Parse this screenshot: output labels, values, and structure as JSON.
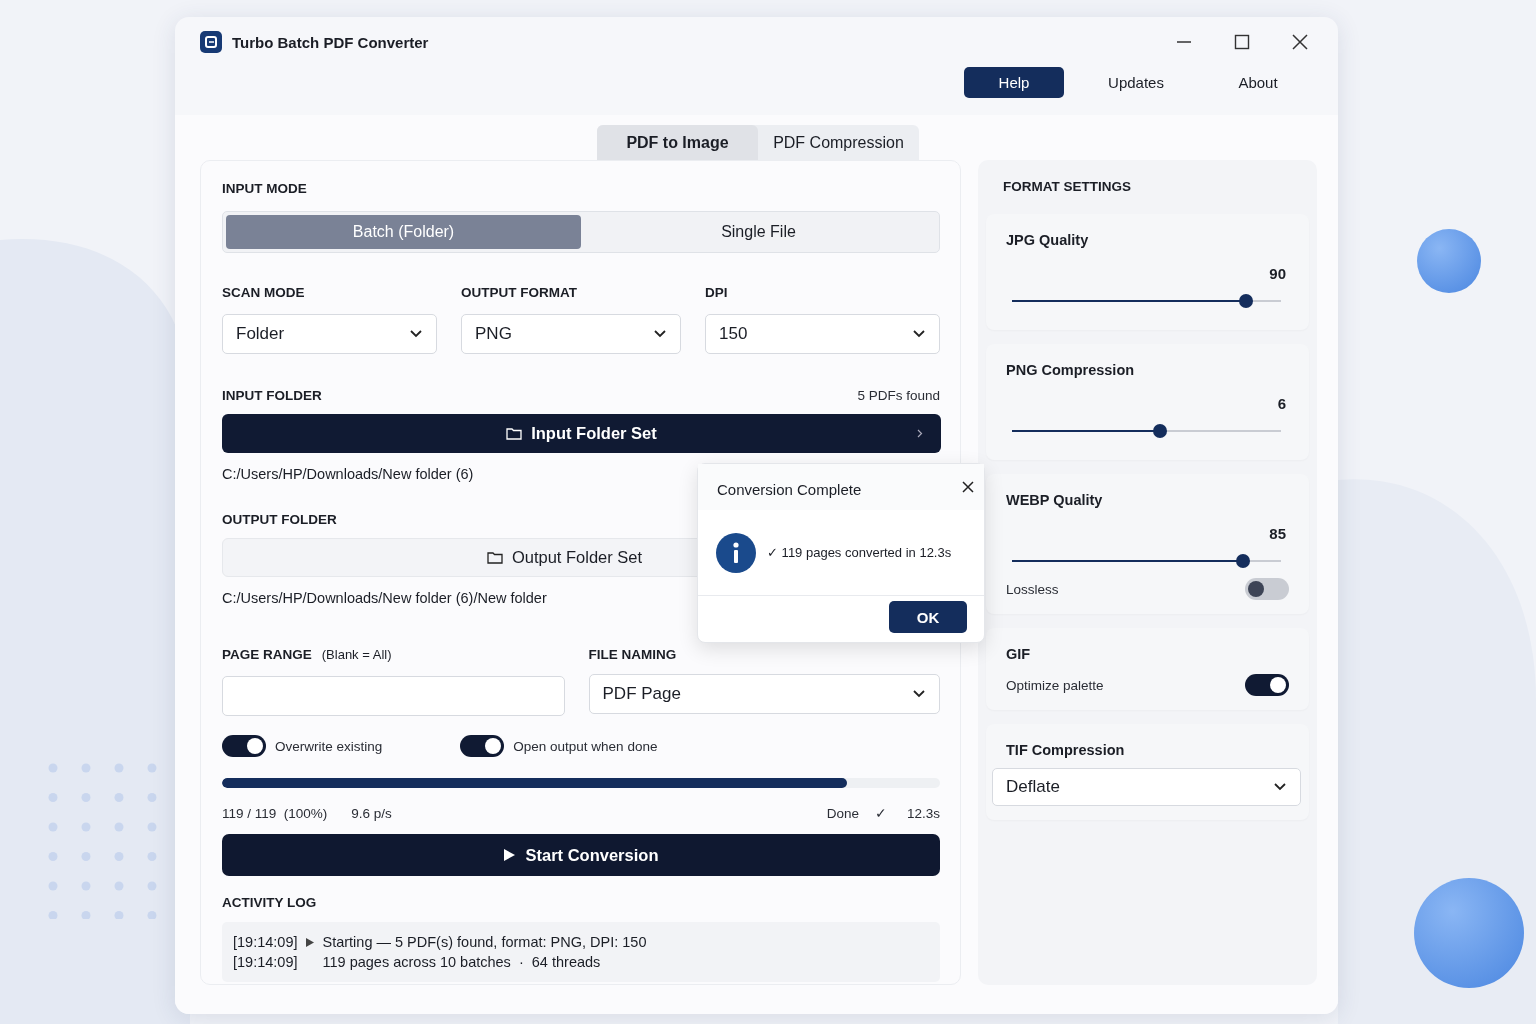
{
  "window": {
    "title": "Turbo Batch PDF Converter"
  },
  "nav_buttons": [
    {
      "label": "Help",
      "selected": true
    },
    {
      "label": "Updates",
      "selected": false
    },
    {
      "label": "About",
      "selected": false
    }
  ],
  "tabs": [
    {
      "label": "PDF to Image",
      "selected": true
    },
    {
      "label": "PDF Compression",
      "selected": false
    }
  ],
  "input_mode": {
    "label": "INPUT MODE",
    "options": [
      {
        "label": "Batch (Folder)",
        "selected": true
      },
      {
        "label": "Single File",
        "selected": false
      }
    ]
  },
  "selects": [
    {
      "label": "SCAN MODE",
      "value": "Folder"
    },
    {
      "label": "OUTPUT FORMAT",
      "value": "PNG"
    },
    {
      "label": "DPI",
      "value": "150"
    }
  ],
  "input_folder": {
    "label": "INPUT FOLDER",
    "count": "5 PDFs found",
    "button": "Input Folder Set",
    "path": "C:/Users/HP/Downloads/New folder (6)"
  },
  "output_folder": {
    "label": "OUTPUT FOLDER",
    "button": "Output Folder Set",
    "path": "C:/Users/HP/Downloads/New folder (6)/New folder"
  },
  "page_range": {
    "label": "PAGE RANGE",
    "hint": "(Blank = All)"
  },
  "file_naming": {
    "label": "FILE NAMING",
    "value": "PDF Page"
  },
  "options": [
    {
      "label": "Overwrite existing",
      "on": true
    },
    {
      "label": "Open output when done",
      "on": true
    }
  ],
  "progress": {
    "level": 0.87,
    "count": "119 / 119  (100%)",
    "rate": "9.6 p/s",
    "status": "Done",
    "check": "✓",
    "time": "12.3s"
  },
  "start_button": "Start Conversion",
  "activity_log": {
    "label": "ACTIVITY LOG",
    "entries": [
      {
        "time": "[19:14:09]",
        "marker": true,
        "message": "Starting — 5 PDF(s) found, format: PNG, DPI: 150"
      },
      {
        "time": "[19:14:09]",
        "marker": false,
        "message": "119 pages across 10 batches  ·  64 threads"
      }
    ]
  },
  "format_settings": {
    "title": "FORMAT SETTINGS",
    "sections": [
      {
        "kind": "slider",
        "title": "JPG Quality",
        "value": "90",
        "level": 0.87
      },
      {
        "kind": "slider",
        "title": "PNG Compression",
        "value": "6",
        "level": 0.55
      },
      {
        "kind": "slider",
        "title": "WEBP Quality",
        "value": "85",
        "level": 0.86,
        "toggle": {
          "label": "Lossless",
          "on": false
        }
      },
      {
        "kind": "toggle",
        "title": "GIF",
        "toggle": {
          "label": "Optimize palette",
          "on": true
        }
      },
      {
        "kind": "select",
        "title": "TIF Compression",
        "value": "Deflate"
      }
    ]
  },
  "dialog": {
    "title": "Conversion Complete",
    "message": "✓ 119 pages converted in 12.3s",
    "button": "OK"
  }
}
